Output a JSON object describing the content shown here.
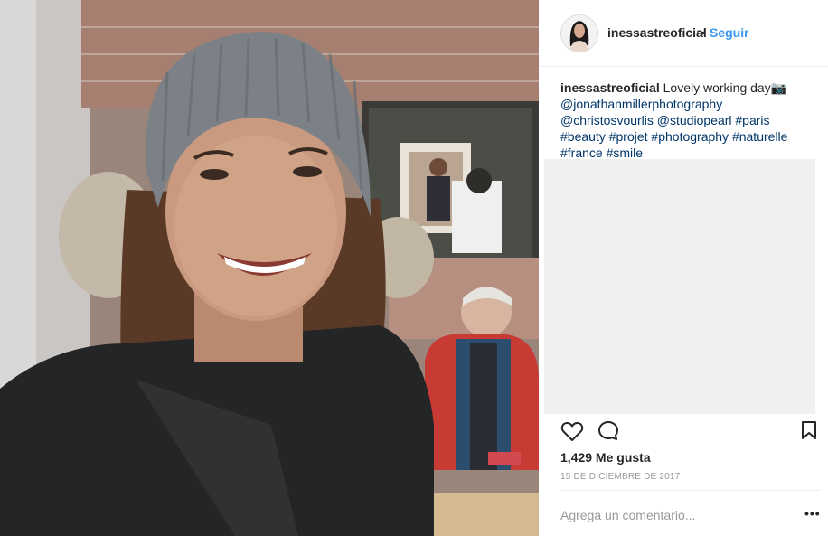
{
  "post": {
    "username": "inessastreoficial",
    "separator": "•",
    "follow_label": "Seguir",
    "caption_text": "Lovely working day📷",
    "caption_links": [
      "@jonathanmillerphotography",
      "@christosvourlis",
      "@studiopearl",
      "#paris",
      "#beauty",
      "#projet",
      "#photography",
      "#naturelle",
      "#france",
      "#smile"
    ],
    "likes": "1,429 Me gusta",
    "date": "15 DE DICIEMBRE DE 2017",
    "comment_placeholder": "Agrega un comentario...",
    "more_label": "•••"
  },
  "icons": {
    "like": "heart-icon",
    "comment": "comment-bubble-icon",
    "save": "bookmark-icon"
  },
  "colors": {
    "accent": "#3897f0",
    "link": "#003569",
    "text": "#262626",
    "muted": "#999999"
  }
}
